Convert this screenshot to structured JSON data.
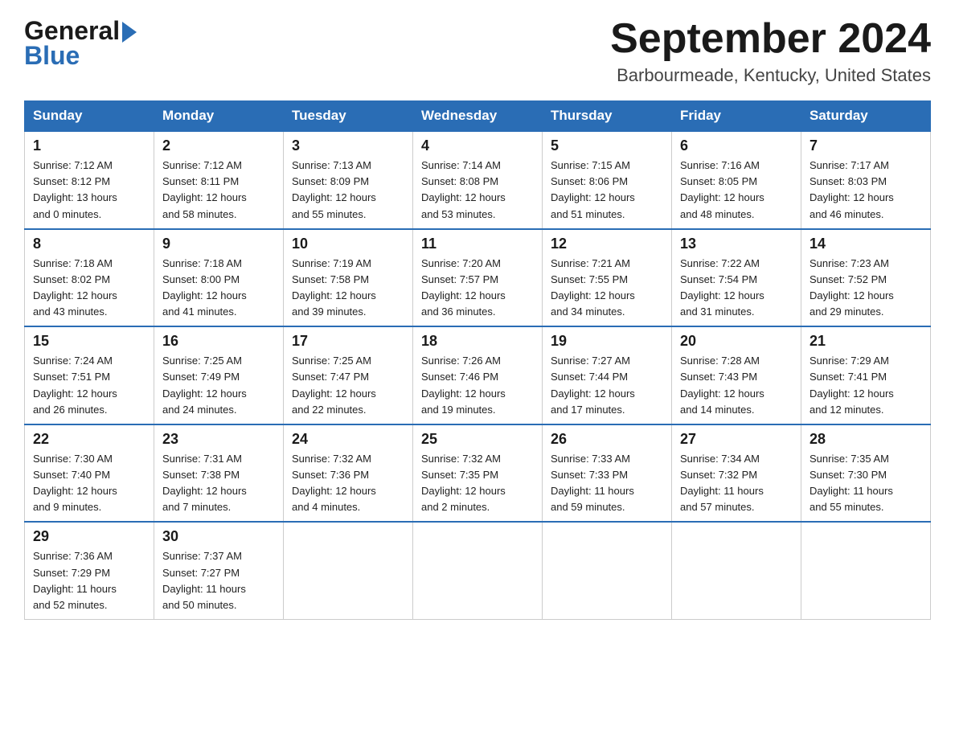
{
  "logo": {
    "line1": "General",
    "line2": "Blue"
  },
  "header": {
    "month": "September 2024",
    "location": "Barbourmeade, Kentucky, United States"
  },
  "weekdays": [
    "Sunday",
    "Monday",
    "Tuesday",
    "Wednesday",
    "Thursday",
    "Friday",
    "Saturday"
  ],
  "weeks": [
    [
      {
        "day": "1",
        "sunrise": "7:12 AM",
        "sunset": "8:12 PM",
        "daylight": "13 hours and 0 minutes."
      },
      {
        "day": "2",
        "sunrise": "7:12 AM",
        "sunset": "8:11 PM",
        "daylight": "12 hours and 58 minutes."
      },
      {
        "day": "3",
        "sunrise": "7:13 AM",
        "sunset": "8:09 PM",
        "daylight": "12 hours and 55 minutes."
      },
      {
        "day": "4",
        "sunrise": "7:14 AM",
        "sunset": "8:08 PM",
        "daylight": "12 hours and 53 minutes."
      },
      {
        "day": "5",
        "sunrise": "7:15 AM",
        "sunset": "8:06 PM",
        "daylight": "12 hours and 51 minutes."
      },
      {
        "day": "6",
        "sunrise": "7:16 AM",
        "sunset": "8:05 PM",
        "daylight": "12 hours and 48 minutes."
      },
      {
        "day": "7",
        "sunrise": "7:17 AM",
        "sunset": "8:03 PM",
        "daylight": "12 hours and 46 minutes."
      }
    ],
    [
      {
        "day": "8",
        "sunrise": "7:18 AM",
        "sunset": "8:02 PM",
        "daylight": "12 hours and 43 minutes."
      },
      {
        "day": "9",
        "sunrise": "7:18 AM",
        "sunset": "8:00 PM",
        "daylight": "12 hours and 41 minutes."
      },
      {
        "day": "10",
        "sunrise": "7:19 AM",
        "sunset": "7:58 PM",
        "daylight": "12 hours and 39 minutes."
      },
      {
        "day": "11",
        "sunrise": "7:20 AM",
        "sunset": "7:57 PM",
        "daylight": "12 hours and 36 minutes."
      },
      {
        "day": "12",
        "sunrise": "7:21 AM",
        "sunset": "7:55 PM",
        "daylight": "12 hours and 34 minutes."
      },
      {
        "day": "13",
        "sunrise": "7:22 AM",
        "sunset": "7:54 PM",
        "daylight": "12 hours and 31 minutes."
      },
      {
        "day": "14",
        "sunrise": "7:23 AM",
        "sunset": "7:52 PM",
        "daylight": "12 hours and 29 minutes."
      }
    ],
    [
      {
        "day": "15",
        "sunrise": "7:24 AM",
        "sunset": "7:51 PM",
        "daylight": "12 hours and 26 minutes."
      },
      {
        "day": "16",
        "sunrise": "7:25 AM",
        "sunset": "7:49 PM",
        "daylight": "12 hours and 24 minutes."
      },
      {
        "day": "17",
        "sunrise": "7:25 AM",
        "sunset": "7:47 PM",
        "daylight": "12 hours and 22 minutes."
      },
      {
        "day": "18",
        "sunrise": "7:26 AM",
        "sunset": "7:46 PM",
        "daylight": "12 hours and 19 minutes."
      },
      {
        "day": "19",
        "sunrise": "7:27 AM",
        "sunset": "7:44 PM",
        "daylight": "12 hours and 17 minutes."
      },
      {
        "day": "20",
        "sunrise": "7:28 AM",
        "sunset": "7:43 PM",
        "daylight": "12 hours and 14 minutes."
      },
      {
        "day": "21",
        "sunrise": "7:29 AM",
        "sunset": "7:41 PM",
        "daylight": "12 hours and 12 minutes."
      }
    ],
    [
      {
        "day": "22",
        "sunrise": "7:30 AM",
        "sunset": "7:40 PM",
        "daylight": "12 hours and 9 minutes."
      },
      {
        "day": "23",
        "sunrise": "7:31 AM",
        "sunset": "7:38 PM",
        "daylight": "12 hours and 7 minutes."
      },
      {
        "day": "24",
        "sunrise": "7:32 AM",
        "sunset": "7:36 PM",
        "daylight": "12 hours and 4 minutes."
      },
      {
        "day": "25",
        "sunrise": "7:32 AM",
        "sunset": "7:35 PM",
        "daylight": "12 hours and 2 minutes."
      },
      {
        "day": "26",
        "sunrise": "7:33 AM",
        "sunset": "7:33 PM",
        "daylight": "11 hours and 59 minutes."
      },
      {
        "day": "27",
        "sunrise": "7:34 AM",
        "sunset": "7:32 PM",
        "daylight": "11 hours and 57 minutes."
      },
      {
        "day": "28",
        "sunrise": "7:35 AM",
        "sunset": "7:30 PM",
        "daylight": "11 hours and 55 minutes."
      }
    ],
    [
      {
        "day": "29",
        "sunrise": "7:36 AM",
        "sunset": "7:29 PM",
        "daylight": "11 hours and 52 minutes."
      },
      {
        "day": "30",
        "sunrise": "7:37 AM",
        "sunset": "7:27 PM",
        "daylight": "11 hours and 50 minutes."
      },
      null,
      null,
      null,
      null,
      null
    ]
  ],
  "labels": {
    "sunrise": "Sunrise:",
    "sunset": "Sunset:",
    "daylight": "Daylight:"
  }
}
